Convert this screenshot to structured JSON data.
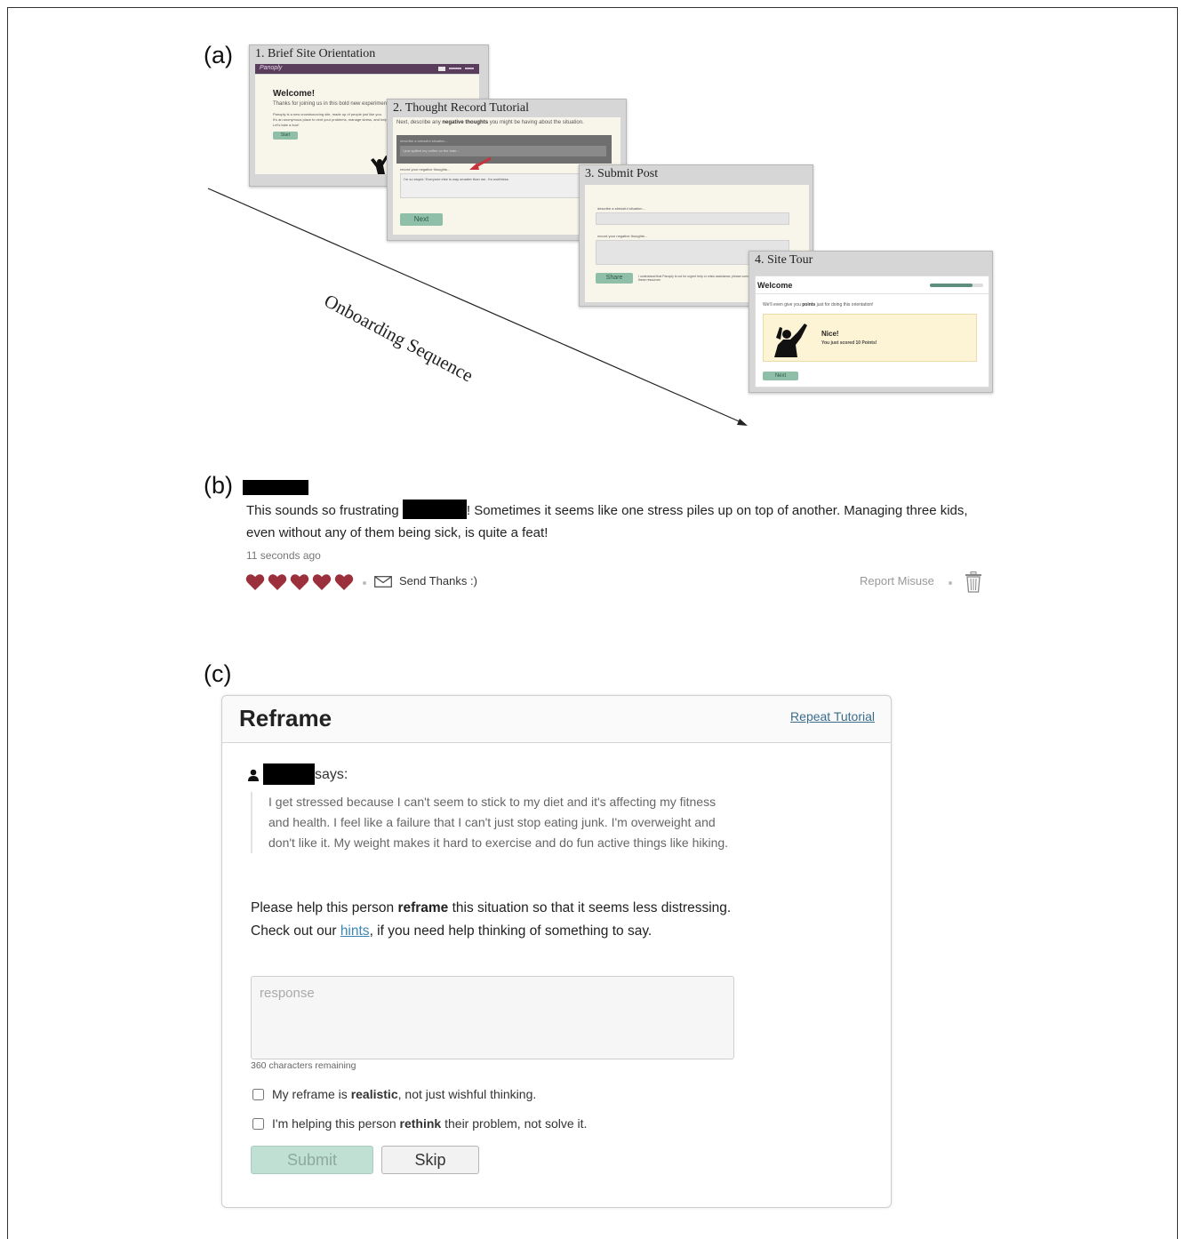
{
  "labels": {
    "a": "(a)",
    "b": "(b)",
    "c": "(c)"
  },
  "onboarding": {
    "sequence_label": "Onboarding Sequence",
    "step1": {
      "title": "1. Brief Site Orientation",
      "brand": "Panoply",
      "welcome": "Welcome!",
      "line1": "Thanks for joining us in this bold new experiment.",
      "line2": "Panoply is a new crowdsourcing site, made up of people just like you.",
      "line3": "It's an anonymous place to vent your problems, manage stress, and help others.",
      "line4": "Let's take a tour!",
      "button": "Start"
    },
    "step2": {
      "title": "2. Thought Record Tutorial",
      "instruction_pre": "Next, describe any ",
      "instruction_bold": "negative thoughts",
      "instruction_post": " you might be having about the situation.",
      "field1_label": "describe a stressful situation...",
      "field1_value": "I just spilled my coffee on the train...",
      "field2_label": "record your negative thoughts...",
      "field2_value": "I'm so stupid. Everyone else is way smarter than me. I'm worthless.",
      "button": "Next"
    },
    "step3": {
      "title": "3. Submit Post",
      "field1_label": "describe a stressful situation...",
      "field2_label": "record your negative thoughts...",
      "button": "Share",
      "disclaimer": "I understand that Panoply is not for urgent help or crisis assistance; please consult these resources"
    },
    "step4": {
      "title": "4. Site Tour",
      "welcome": "Welcome",
      "line_pre": "We'll even give you ",
      "line_bold": "points",
      "line_post": " just for doing this orientation!",
      "nice": "Nice!",
      "score": "You just scored 10 Points!",
      "button": "Next",
      "progress": 0.8
    }
  },
  "comment": {
    "text_part1": "This sounds so frustrating ",
    "text_part2": "! Sometimes it seems like one stress piles up on top of another. Managing three kids, even without any of them being sick, is quite a feat!",
    "time": "11 seconds ago",
    "hearts": 5,
    "send_thanks": "Send Thanks :)",
    "report": "Report Misuse"
  },
  "reframe": {
    "title": "Reframe",
    "repeat_tutorial": "Repeat Tutorial",
    "says": "says:",
    "quote": "I get stressed because I can't seem to stick to my diet and it's affecting my fitness and health. I feel like a failure that I can't just stop eating junk. I'm overweight and don't like it. My weight makes it hard to exercise and do fun active things like hiking.",
    "prompt_pre": "Please help this person ",
    "prompt_bold": "reframe",
    "prompt_mid": " this situation so that it seems less distressing. Check out our ",
    "prompt_link": "hints",
    "prompt_post": ", if you need help thinking of something to say.",
    "response_placeholder": "response",
    "chars_remaining": "360 characters remaining",
    "check1_pre": "My reframe is ",
    "check1_bold": "realistic",
    "check1_post": ", not just wishful thinking.",
    "check2_pre": "I'm helping this person ",
    "check2_bold": "rethink",
    "check2_post": " their problem, not solve it.",
    "submit": "Submit",
    "skip": "Skip"
  },
  "colors": {
    "heart": "#9b2f3c",
    "accent_green": "#8fbfa8",
    "brand_purple": "#5a3d5c",
    "link_blue": "#3a6d8c"
  }
}
